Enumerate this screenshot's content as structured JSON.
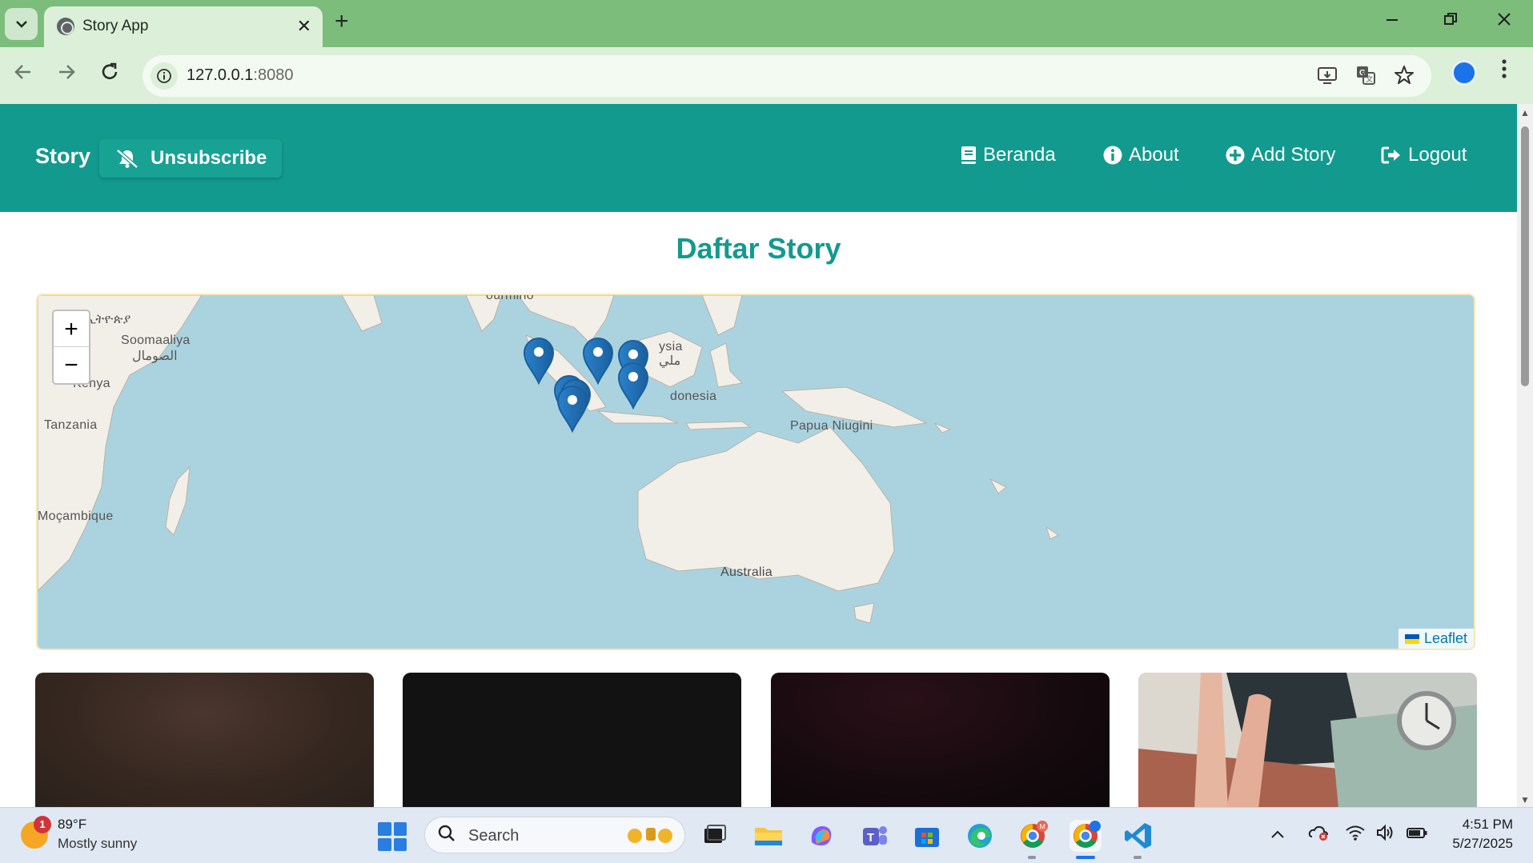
{
  "browser": {
    "tab_title": "Story App",
    "url_host": "127.0.0.1",
    "url_port": ":8080",
    "new_tab_symbol": "+",
    "close_symbol": "✕",
    "colors": {
      "tab_strip": "#7cbd7b",
      "toolbar": "#dcefd9"
    }
  },
  "app": {
    "brand": "Story",
    "unsubscribe_label": "Unsubscribe",
    "nav": {
      "beranda": "Beranda",
      "about": "About",
      "add_story": "Add Story",
      "logout": "Logout"
    },
    "colors": {
      "primary": "#139a8e"
    }
  },
  "main": {
    "title": "Daftar Story"
  },
  "map": {
    "zoom_in": "+",
    "zoom_out": "−",
    "attribution": "Leaflet",
    "place_labels": {
      "ethiopia": "ኢትዮጵያ",
      "somalia": "Soomaaliya",
      "somalia_ar": "الصومال",
      "kenya": "Kenya",
      "tanzania": "Tanzania",
      "mozambique": "Moçambique",
      "malaysia": "ysia",
      "malaysia_ar": "ملي",
      "indonesia": "donesia",
      "png": "Papua Niugini",
      "australia": "Australia",
      "top_cut": "ourmino"
    },
    "marker_count": 7
  },
  "stories": [
    {
      "thumbnail": "dark-brown-photo"
    },
    {
      "thumbnail": "black-photo"
    },
    {
      "thumbnail": "dark-red-photo"
    },
    {
      "thumbnail": "hand-peace-sign-with-clock-photo"
    }
  ],
  "taskbar": {
    "weather_badge": "1",
    "temperature": "89°F",
    "condition": "Mostly sunny",
    "search_placeholder": "Search",
    "time": "4:51 PM",
    "date": "5/27/2025"
  }
}
